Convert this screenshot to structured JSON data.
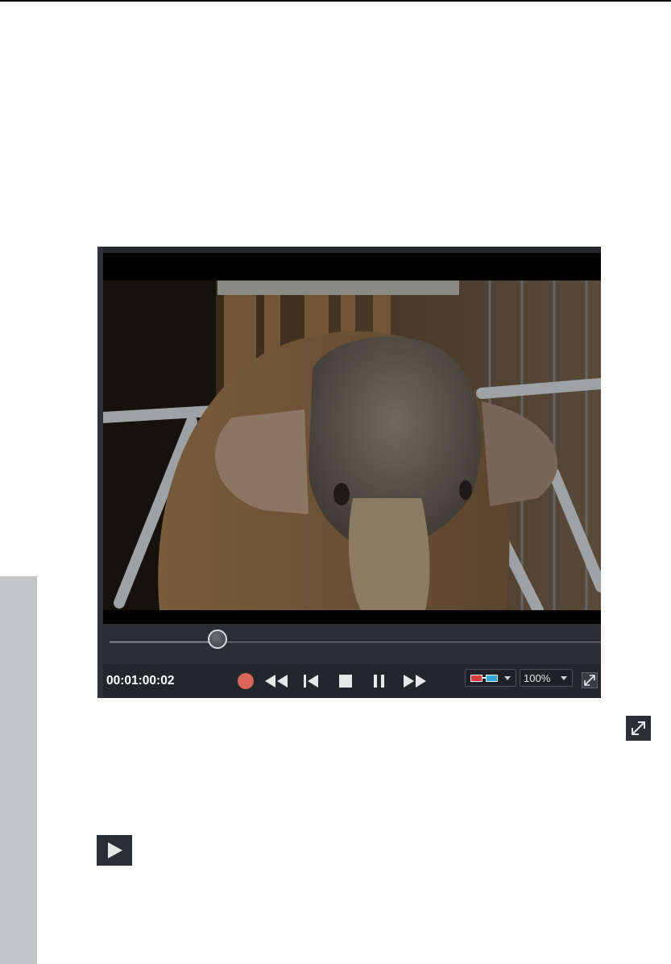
{
  "player": {
    "timecode": "00:01:00:02",
    "playhead_progress": 0.22,
    "zoom": {
      "selected": "100%"
    },
    "icons": {
      "record": "record-icon",
      "rewind": "rewind-icon",
      "skip_start": "skip-to-start-icon",
      "stop": "stop-icon",
      "pause": "pause-icon",
      "fast_forward": "fast-forward-icon",
      "stereo_3d": "anaglyph-3d-glasses-icon",
      "fullscreen": "fullscreen-icon"
    },
    "colors": {
      "panel": "#23262b",
      "record": "#d9665b",
      "anaglyph_left": "#e23b3b",
      "anaglyph_right": "#32a8e0"
    }
  },
  "inline_icons": {
    "fullscreen": "fullscreen-icon",
    "play": "play-icon"
  }
}
